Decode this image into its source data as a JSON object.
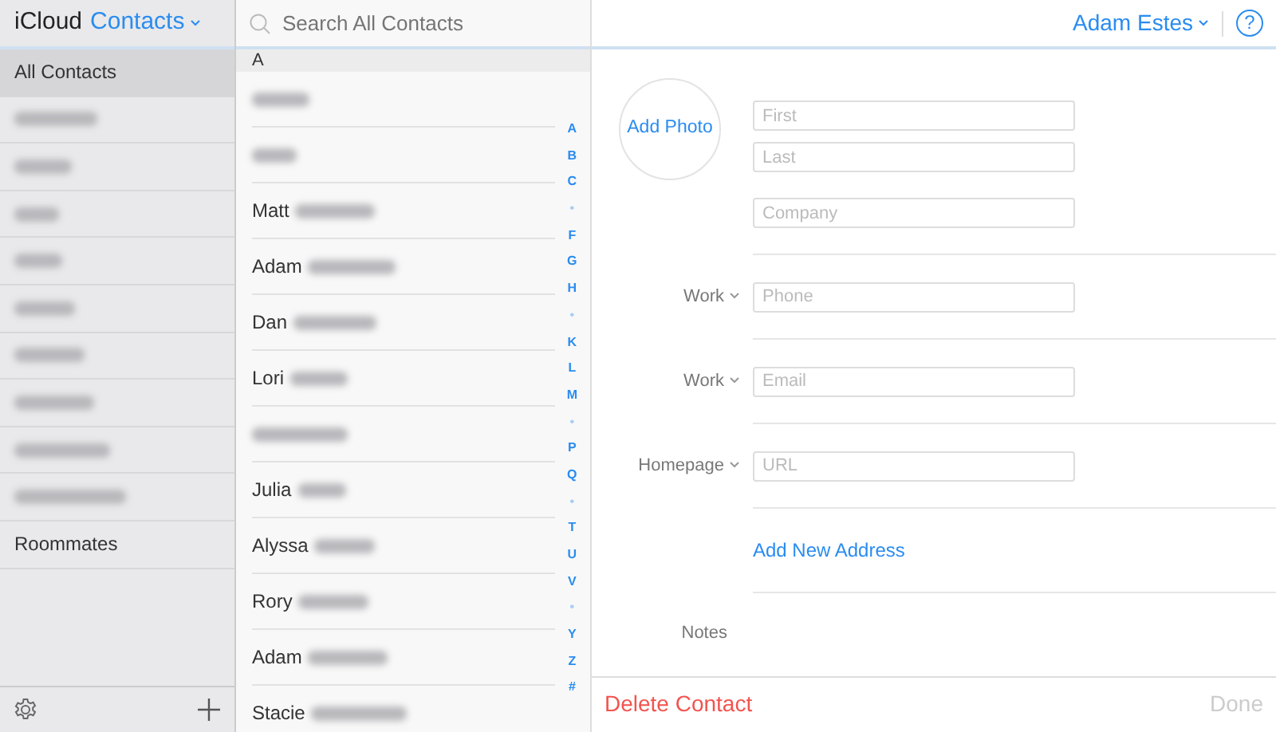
{
  "header": {
    "brand": "iCloud",
    "title": "Contacts"
  },
  "groups": [
    {
      "kind": "text",
      "label": "All Contacts",
      "selected": true
    },
    {
      "kind": "blurred",
      "selected": false
    },
    {
      "kind": "blurred",
      "selected": false
    },
    {
      "kind": "blurred",
      "selected": false
    },
    {
      "kind": "blurred",
      "selected": false
    },
    {
      "kind": "blurred",
      "selected": false
    },
    {
      "kind": "blurred",
      "selected": false
    },
    {
      "kind": "blurred",
      "selected": false
    },
    {
      "kind": "blurred",
      "selected": false
    },
    {
      "kind": "blurred",
      "selected": false
    },
    {
      "kind": "text",
      "label": "Roommates",
      "selected": false
    }
  ],
  "search": {
    "placeholder": "Search All Contacts"
  },
  "section": "A",
  "contacts": [
    {
      "kind": "blurred"
    },
    {
      "kind": "blurred"
    },
    {
      "kind": "named",
      "first": "Matt"
    },
    {
      "kind": "named",
      "first": "Adam"
    },
    {
      "kind": "named",
      "first": "Dan"
    },
    {
      "kind": "named",
      "first": "Lori"
    },
    {
      "kind": "blurred"
    },
    {
      "kind": "named",
      "first": "Julia"
    },
    {
      "kind": "named",
      "first": "Alyssa"
    },
    {
      "kind": "named",
      "first": "Rory"
    },
    {
      "kind": "named",
      "first": "Adam"
    },
    {
      "kind": "named",
      "first": "Stacie"
    }
  ],
  "index": [
    {
      "kind": "letter",
      "text": "A"
    },
    {
      "kind": "letter",
      "text": "B"
    },
    {
      "kind": "letter",
      "text": "C"
    },
    {
      "kind": "dot",
      "text": "•"
    },
    {
      "kind": "letter",
      "text": "F"
    },
    {
      "kind": "letter",
      "text": "G"
    },
    {
      "kind": "letter",
      "text": "H"
    },
    {
      "kind": "dot",
      "text": "•"
    },
    {
      "kind": "letter",
      "text": "K"
    },
    {
      "kind": "letter",
      "text": "L"
    },
    {
      "kind": "letter",
      "text": "M"
    },
    {
      "kind": "dot",
      "text": "•"
    },
    {
      "kind": "letter",
      "text": "P"
    },
    {
      "kind": "letter",
      "text": "Q"
    },
    {
      "kind": "dot",
      "text": "•"
    },
    {
      "kind": "letter",
      "text": "T"
    },
    {
      "kind": "letter",
      "text": "U"
    },
    {
      "kind": "letter",
      "text": "V"
    },
    {
      "kind": "dot",
      "text": "•"
    },
    {
      "kind": "letter",
      "text": "Y"
    },
    {
      "kind": "letter",
      "text": "Z"
    },
    {
      "kind": "letter",
      "text": "#"
    }
  ],
  "user": {
    "name": "Adam Estes",
    "help": "?"
  },
  "form": {
    "photo": "Add Photo",
    "name_fields": [
      {
        "placeholder": "First"
      },
      {
        "placeholder": "Last"
      },
      {
        "placeholder": "Company"
      }
    ],
    "entries": [
      {
        "label": "Work",
        "placeholder": "Phone"
      },
      {
        "label": "Work",
        "placeholder": "Email"
      },
      {
        "label": "Homepage",
        "placeholder": "URL"
      }
    ],
    "add_address": "Add New Address",
    "notes_label": "Notes"
  },
  "footer": {
    "delete": "Delete Contact",
    "done": {
      "label": "Done",
      "disabled": true
    }
  }
}
